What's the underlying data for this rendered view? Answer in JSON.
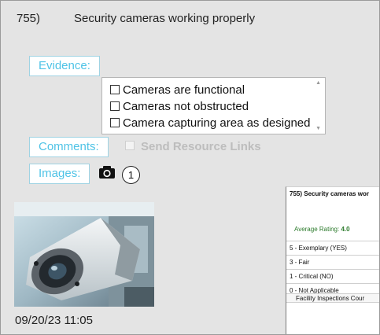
{
  "question": {
    "number": "755)",
    "text": "Security cameras working properly"
  },
  "evidence": {
    "label": "Evidence:",
    "items": [
      "Cameras are functional",
      "Cameras not obstructed",
      "Camera capturing area as designed"
    ]
  },
  "comments": {
    "label": "Comments:",
    "send_resource_links": "Send Resource Links"
  },
  "images": {
    "label": "Images:",
    "count": "1",
    "timestamp": "09/20/23 11:05"
  },
  "icons": {
    "camera": "camera-icon",
    "scroll_up": "scroll-up-arrow",
    "scroll_down": "scroll-down-arrow"
  },
  "report": {
    "title": "755) Security cameras wor",
    "average_label": "Average Rating:",
    "average_value": "4.0",
    "ratings": [
      "5 - Exemplary (YES)",
      "3 - Fair",
      "1 - Critical (NO)",
      "0 - Not Applicable"
    ],
    "footer": "Facility Inspections Cour"
  },
  "colors": {
    "label_text": "#4fc3e6",
    "label_border": "#9fd3e3",
    "average_green": "#2b7a2b",
    "panel_bg": "#e4e4e4"
  }
}
